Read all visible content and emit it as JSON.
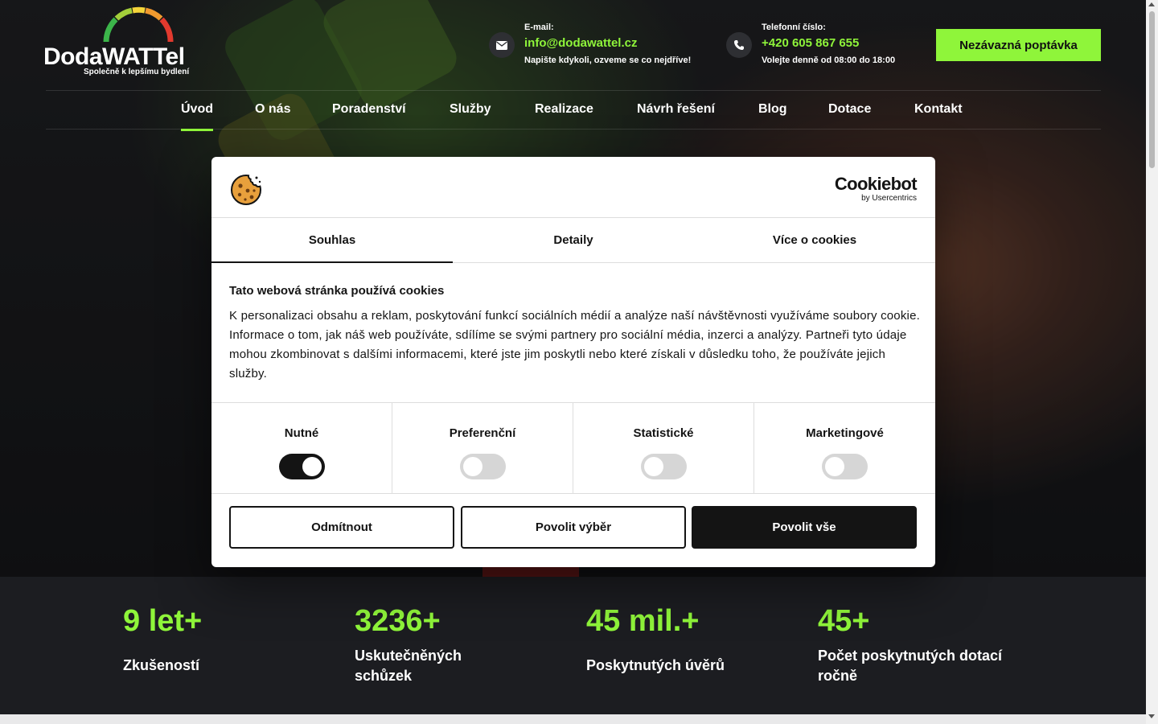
{
  "header": {
    "logo": {
      "text_prefix": "Doda",
      "text_suffix": "WATTel",
      "tagline": "Společně k lepšímu bydlení"
    },
    "email": {
      "label": "E-mail:",
      "value": "info@dodawattel.cz",
      "note": "Napište kdykoli, ozveme se co nejdříve!"
    },
    "phone": {
      "label": "Telefonní číslo:",
      "value": "+420 605 867 655",
      "note": "Volejte denně od 08:00 do 18:00"
    },
    "cta_label": "Nezávazná poptávka"
  },
  "nav": {
    "items": [
      "Úvod",
      "O nás",
      "Poradenství",
      "Služby",
      "Realizace",
      "Návrh řešení",
      "Blog",
      "Dotace",
      "Kontakt"
    ],
    "active": "Úvod"
  },
  "cookie_dialog": {
    "brand": {
      "name": "Cookiebot",
      "sub": "by Usercentrics"
    },
    "tabs": [
      "Souhlas",
      "Detaily",
      "Více o cookies"
    ],
    "active_tab": "Souhlas",
    "title": "Tato webová stránka používá cookies",
    "text": "K personalizaci obsahu a reklam, poskytování funkcí sociálních médií a analýze naší návštěvnosti využíváme soubory cookie. Informace o tom, jak náš web používáte, sdílíme se svými partnery pro sociální média, inzerci a analýzy. Partneři tyto údaje mohou zkombinovat s dalšími informacemi, které jste jim poskytli nebo které získali v důsledku toho, že používáte jejich služby.",
    "toggles": [
      {
        "label": "Nutné",
        "on": true
      },
      {
        "label": "Preferenční",
        "on": false
      },
      {
        "label": "Statistické",
        "on": false
      },
      {
        "label": "Marketingové",
        "on": false
      }
    ],
    "buttons": {
      "deny": "Odmítnout",
      "allow_selection": "Povolit výběr",
      "allow_all": "Povolit vše"
    }
  },
  "stats": [
    {
      "value": "9 let+",
      "label": "Zkušeností"
    },
    {
      "value": "3236+",
      "label": "Uskutečněných schůzek"
    },
    {
      "value": "45 mil.+",
      "label": "Poskytnutých úvěrů"
    },
    {
      "value": "45+",
      "label": "Počet poskytnutých dotací ročně"
    }
  ],
  "colors": {
    "accent": "#8ff53a",
    "dark": "#141414",
    "background": "#1c1d21"
  }
}
